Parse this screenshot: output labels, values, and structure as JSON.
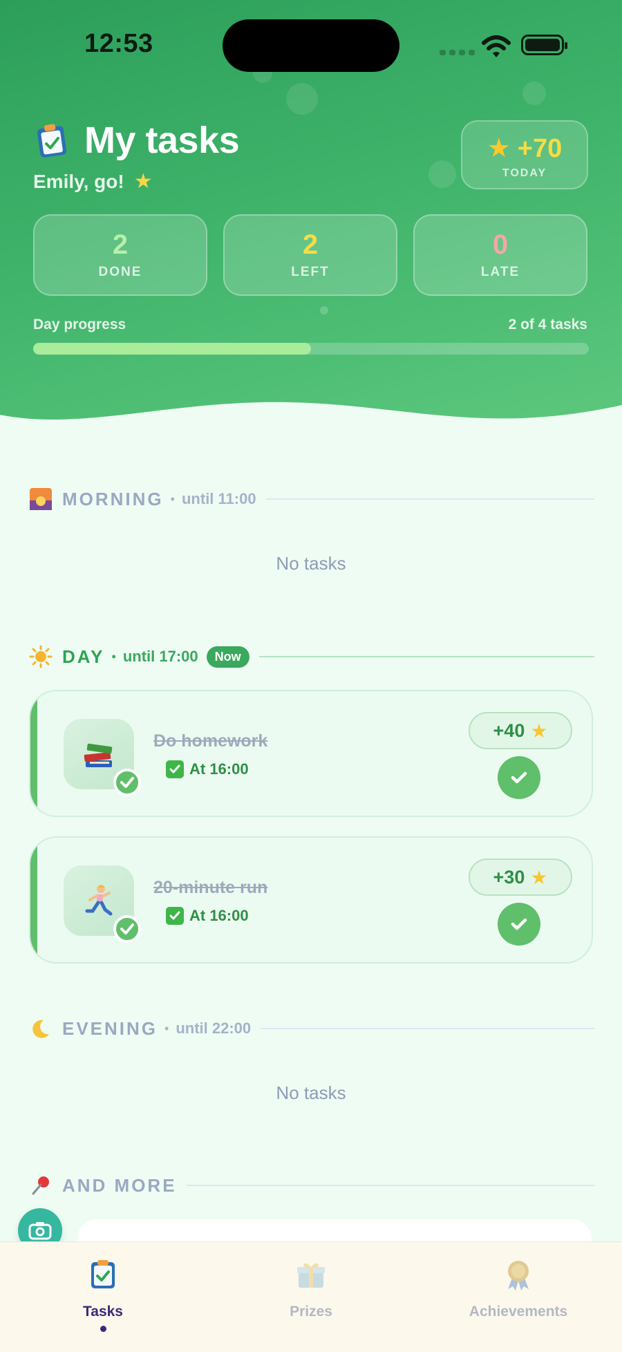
{
  "status_bar": {
    "time": "12:53"
  },
  "header": {
    "title": "My tasks",
    "subtitle": "Emily, go!",
    "score": {
      "value": "+70",
      "label": "TODAY"
    },
    "stats": [
      {
        "value": "2",
        "label": "DONE",
        "color": "#b7f0a8"
      },
      {
        "value": "2",
        "label": "LEFT",
        "color": "#f8dc44"
      },
      {
        "value": "0",
        "label": "LATE",
        "color": "#f5a6a6"
      }
    ],
    "progress": {
      "label": "Day progress",
      "count_text": "2 of 4 tasks",
      "fraction": 0.5
    }
  },
  "sections": {
    "morning": {
      "name": "MORNING",
      "until": "until 11:00",
      "empty_text": "No tasks"
    },
    "day": {
      "name": "DAY",
      "until": "until 17:00",
      "badge": "Now",
      "tasks": [
        {
          "title": "Do homework",
          "time": "At 16:00",
          "reward": "+40",
          "icon": "books-icon"
        },
        {
          "title": "20-minute run",
          "time": "At 16:00",
          "reward": "+30",
          "icon": "runner-icon"
        }
      ]
    },
    "evening": {
      "name": "EVENING",
      "until": "until 22:00",
      "empty_text": "No tasks"
    },
    "more": {
      "name": "AND MORE"
    }
  },
  "tabs": [
    {
      "label": "Tasks",
      "icon": "clipboard-icon",
      "active": true
    },
    {
      "label": "Prizes",
      "icon": "gift-icon",
      "active": false
    },
    {
      "label": "Achievements",
      "icon": "medal-icon",
      "active": false
    }
  ],
  "colors": {
    "accent_green": "#3aa85d",
    "tab_active": "#3b2a7a"
  }
}
